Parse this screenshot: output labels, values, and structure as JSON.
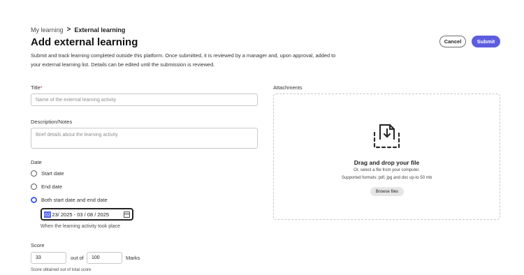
{
  "breadcrumb": {
    "parent": "My learning",
    "separator": ">",
    "current": "External learning"
  },
  "page_title": "Add external learning",
  "description": "Submit and track learning completed outside this platform. Once submitted, it is reviewed by a manager and, upon approval, added to your external learning list. Details can be edited until the submission is reviewed.",
  "actions": {
    "cancel_label": "Cancel",
    "submit_label": "Submit"
  },
  "form": {
    "title": {
      "label": "Title",
      "required_marker": "*",
      "placeholder": "Name of the external learning activity"
    },
    "description": {
      "label": "Description/Notes",
      "placeholder": "Brief details about the learning activity"
    },
    "date": {
      "label": "Date",
      "options": [
        "Start date",
        "End date",
        "Both start date and end date"
      ],
      "selected_option": "Both start date and end date",
      "range_highlight": "02",
      "range_value": "23/ 2025 - 03 / 08 / 2025",
      "help_text": "When the learning activity took place"
    },
    "score": {
      "label": "Score",
      "value": "33",
      "out_of_label": "out of",
      "total": "100",
      "unit": "Marks",
      "help_text": "Score obtained out of total score"
    }
  },
  "attachments": {
    "label": "Attachments",
    "dropzone_title": "Drag and drop your file",
    "dropzone_subtitle": "Or, select a file from your computer.",
    "supported_formats": "Supported formats: pdf, jpg and doc up-to 50 mb",
    "browse_label": "Browse files",
    "icon": "upload-file-icon"
  },
  "colors": {
    "accent": "#5c5ce0",
    "radio_selected": "#4b5ff1",
    "required": "#d7373f"
  }
}
